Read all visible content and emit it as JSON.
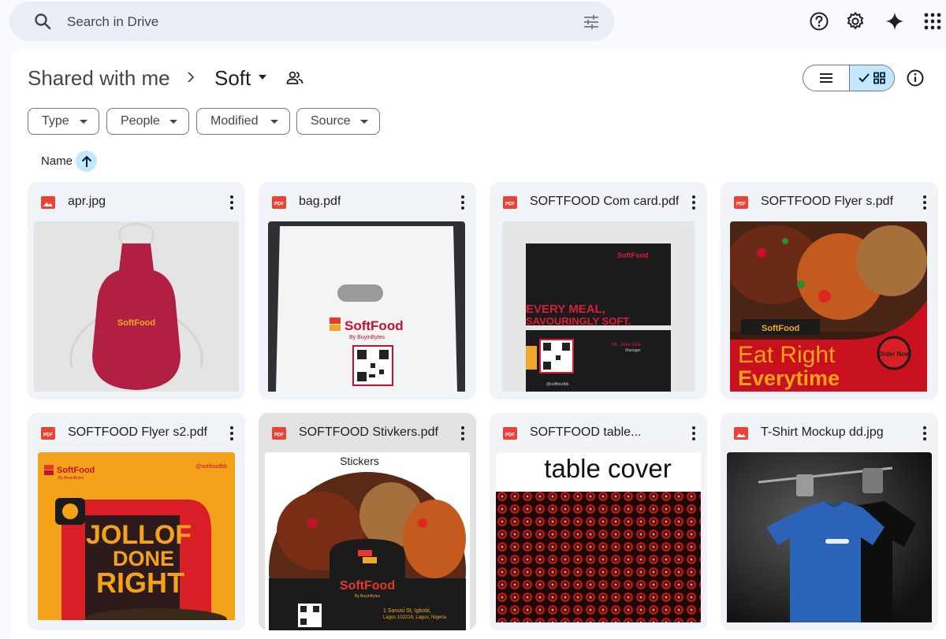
{
  "search": {
    "placeholder": "Search in Drive"
  },
  "breadcrumb": {
    "root": "Shared with me",
    "current": "Soft"
  },
  "filters": [
    "Type",
    "People",
    "Modified",
    "Source"
  ],
  "sort": {
    "label": "Name",
    "direction": "ascending"
  },
  "colors": {
    "accent": "#c2e7ff",
    "brand_red": "#c8102e",
    "pdf_red": "#ea4335"
  },
  "files": [
    {
      "name": "apr.jpg",
      "kind": "image"
    },
    {
      "name": "bag.pdf",
      "kind": "pdf"
    },
    {
      "name": "SOFTFOOD Com card.pdf",
      "kind": "pdf"
    },
    {
      "name": "SOFTFOOD Flyer s.pdf",
      "kind": "pdf"
    },
    {
      "name": "SOFTFOOD Flyer s2.pdf",
      "kind": "pdf"
    },
    {
      "name": "SOFTFOOD Stivkers.pdf",
      "kind": "pdf"
    },
    {
      "name": "SOFTFOOD table...",
      "kind": "pdf"
    },
    {
      "name": "T-Shirt Mockup dd.jpg",
      "kind": "image"
    }
  ],
  "thumbs": {
    "apron_brand": "SoftFood",
    "bag_brand": "SoftFood",
    "bag_sub": "By BuyinBytes",
    "card_headline1": "EVERY MEAL,",
    "card_headline2": "SAVOURINGLY SOFT.",
    "card_brand": "SoftFood",
    "card_person": "Mr. Jolen Doe",
    "card_role": "Manager",
    "card_social": "@softfoodbb",
    "flyer1_brand": "SoftFood",
    "flyer1_line1": "Eat Right",
    "flyer1_line2": "Everytime",
    "flyer1_badge": "Order Now",
    "flyer2_brand": "SoftFood",
    "flyer2_sub": "By BuyinBytes",
    "flyer2_social": "@softfoodbb",
    "flyer2_l1": "JOLLOF",
    "flyer2_l2": "DONE",
    "flyer2_l3": "RIGHT",
    "stickers_title": "Stickers",
    "stickers_brand": "SoftFood",
    "stickers_sub": "By BuyinBytes",
    "stickers_addr1": "1 Sanusi St, Igbobi,",
    "stickers_addr2": "Lagos 102216, Lagos, Nigeria",
    "table_title": "table cover"
  }
}
